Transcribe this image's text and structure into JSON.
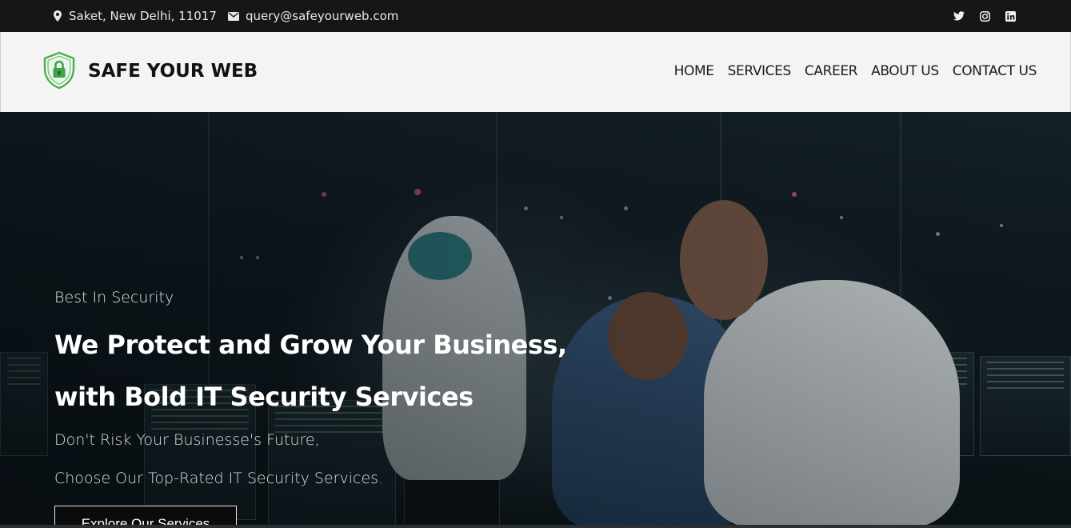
{
  "topbar": {
    "address": "Saket, New Delhi, 11017",
    "email": "query@safeyourweb.com",
    "social": [
      "twitter-icon",
      "instagram-icon",
      "linkedin-icon"
    ]
  },
  "header": {
    "brand": "SAFE YOUR WEB",
    "nav": [
      "HOME",
      "SERVICES",
      "CAREER",
      "ABOUT US",
      "CONTACT US"
    ]
  },
  "hero": {
    "tagline": "Best In Security",
    "headline_1": "We Protect and Grow Your Business,",
    "headline_2": "with Bold IT Security Services",
    "sub_1": "Don't Risk Your Businesse's Future,",
    "sub_2": "Choose Our Top-Rated IT Security Services.",
    "cta": "Explore Our Services"
  },
  "colors": {
    "topbar_bg": "#161616",
    "header_bg": "#f4f4f4",
    "logo_green": "#4caf50"
  }
}
